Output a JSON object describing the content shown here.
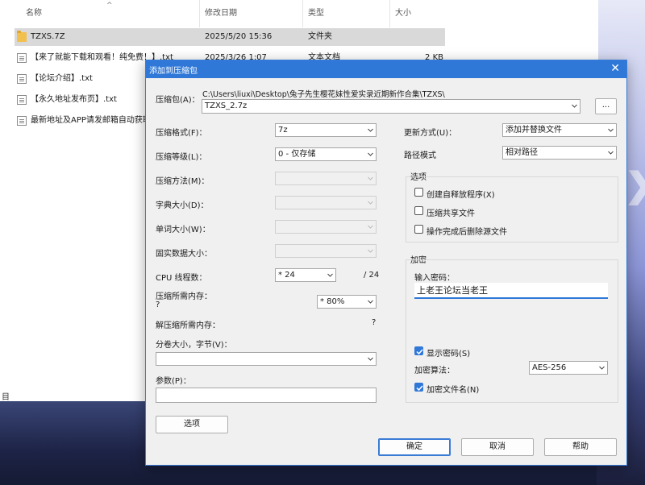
{
  "explorer": {
    "columns": [
      "名称",
      "修改日期",
      "类型",
      "大小"
    ],
    "files": [
      {
        "name": "TZXS.7Z",
        "date": "2025/5/20 15:36",
        "type": "文件夹",
        "size": "",
        "icon": "folder-icon"
      },
      {
        "name": "【来了就能下载和观看！纯免费！】.txt",
        "date": "2025/3/26 1:07",
        "type": "文本文档",
        "size": "2 KB",
        "icon": "txt-file-icon"
      },
      {
        "name": "【论坛介绍】.txt",
        "date": "",
        "type": "",
        "size": "",
        "icon": "txt-file-icon"
      },
      {
        "name": "【永久地址发布页】.txt",
        "date": "",
        "type": "",
        "size": "",
        "icon": "txt-file-icon"
      },
      {
        "name": "最新地址及APP请发邮箱自动获取",
        "date": "",
        "type": "",
        "size": "",
        "icon": "txt-file-icon"
      }
    ],
    "left_edge_text": "目"
  },
  "dialog": {
    "title": "添加到压缩包",
    "archive_label": "压缩包(A)：",
    "archive_path": "C:\\Users\\liuxi\\Desktop\\兔子先生樱花妹性爱实录近期新作合集\\TZXS\\",
    "archive_name": "TZXS_2.7z",
    "browse_label": "...",
    "left": {
      "format_label": "压缩格式(F)：",
      "format_value": "7z",
      "level_label": "压缩等级(L)：",
      "level_value": "0 - 仅存储",
      "method_label": "压缩方法(M)：",
      "dict_label": "字典大小(D)：",
      "word_label": "单词大小(W)：",
      "solid_label": "固实数据大小：",
      "cpu_label": "CPU 线程数：",
      "cpu_value": "* 24",
      "cpu_total": "/ 24",
      "mem_label": "压缩所需内存：",
      "mem_value": "* 80%",
      "mem_q": "?",
      "decmem_label": "解压缩所需内存：",
      "decmem_q": "?",
      "split_label": "分卷大小，字节(V)：",
      "params_label": "参数(P)：",
      "options_button": "选项"
    },
    "right": {
      "update_label": "更新方式(U)：",
      "update_value": "添加并替换文件",
      "path_label": "路径模式",
      "path_value": "相对路径",
      "options_group": "选项",
      "opt_sfx": "创建自释放程序(X)",
      "opt_sfx_checked": false,
      "opt_shared": "压缩共享文件",
      "opt_shared_checked": false,
      "opt_delete": "操作完成后删除源文件",
      "opt_delete_checked": false,
      "enc_group": "加密",
      "pw_label": "输入密码：",
      "pw_value": "上老王论坛当老王",
      "show_pw": "显示密码(S)",
      "show_pw_checked": true,
      "enc_method_label": "加密算法：",
      "enc_method_value": "AES-256",
      "enc_names": "加密文件名(N)",
      "enc_names_checked": true
    },
    "buttons": {
      "ok": "确定",
      "cancel": "取消",
      "help": "帮助"
    }
  }
}
